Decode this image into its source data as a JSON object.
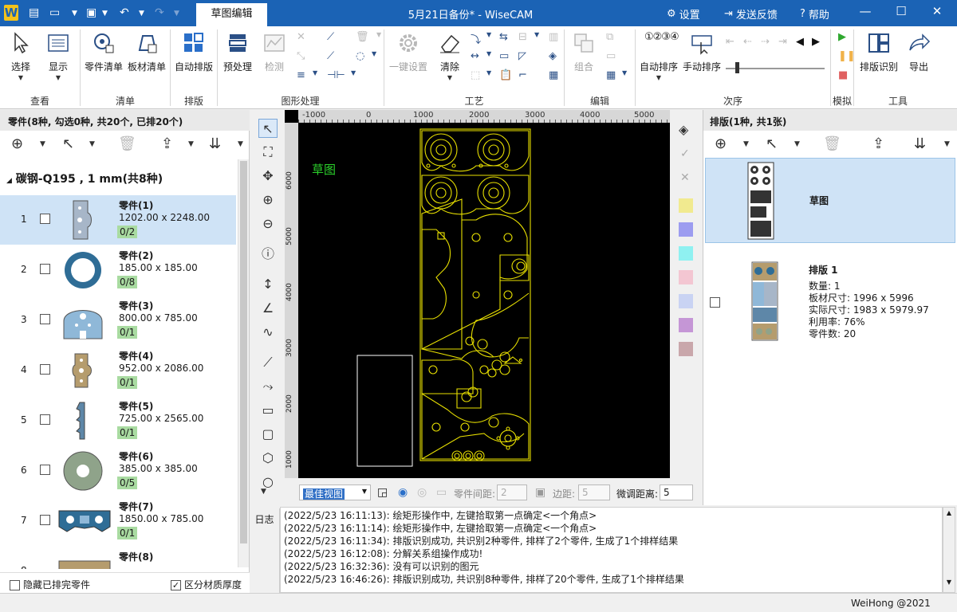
{
  "titlebar": {
    "logo": "W",
    "active_tab": "草图编辑",
    "title": "5月21日备份* - WiseCAM",
    "settings": "设置",
    "feedback": "发送反馈",
    "help": "帮助"
  },
  "ribbon": {
    "select": "选择",
    "display": "显示",
    "part_list": "零件清单",
    "sheet_list": "板材清单",
    "auto_nest": "自动排版",
    "preprocess": "预处理",
    "check": "检测",
    "one_click": "一键设置",
    "clear": "清除",
    "combine": "组合",
    "auto_sort": "自动排序",
    "manual_sort": "手动排序",
    "nest_recognize": "排版识别",
    "export": "导出",
    "order_icon_text": "①②③④",
    "groups": {
      "view": "查看",
      "list": "清单",
      "nest": "排版",
      "shape": "图形处理",
      "process": "工艺",
      "edit": "编辑",
      "order": "次序",
      "sim": "模拟",
      "tools": "工具"
    }
  },
  "left_panel": {
    "header": "零件(8种, 勾选0种, 共20个, 已排20个)",
    "group_title": "碳钢-Q195 , 1 mm(共8种)",
    "parts": [
      {
        "idx": "1",
        "name": "零件(1)",
        "dim": "1202.00 x 2248.00",
        "count": "0/2"
      },
      {
        "idx": "2",
        "name": "零件(2)",
        "dim": "185.00 x 185.00",
        "count": "0/8"
      },
      {
        "idx": "3",
        "name": "零件(3)",
        "dim": "800.00 x 785.00",
        "count": "0/1"
      },
      {
        "idx": "4",
        "name": "零件(4)",
        "dim": "952.00 x 2086.00",
        "count": "0/1"
      },
      {
        "idx": "5",
        "name": "零件(5)",
        "dim": "725.00 x 2565.00",
        "count": "0/1"
      },
      {
        "idx": "6",
        "name": "零件(6)",
        "dim": "385.00 x 385.00",
        "count": "0/5"
      },
      {
        "idx": "7",
        "name": "零件(7)",
        "dim": "1850.00 x 785.00",
        "count": "0/1"
      },
      {
        "idx": "8",
        "name": "零件(8)",
        "dim": "",
        "count": ""
      }
    ],
    "footer_hide": "隐藏已排完零件",
    "footer_split": "区分材质厚度",
    "footer_split_checked": "✓"
  },
  "canvas": {
    "label": "草图",
    "ruler_ticks": [
      "-1000",
      "0",
      "1000",
      "2000",
      "3000",
      "4000",
      "5000"
    ],
    "ruler_left_ticks": [
      "6000",
      "5000",
      "4000",
      "3000",
      "2000",
      "1000"
    ],
    "view_mode": "最佳视图",
    "part_gap_label": "零件间距:",
    "part_gap_value": "2",
    "margin_label": "边距:",
    "margin_value": "5",
    "fine_label": "微调距离:",
    "fine_value": "5"
  },
  "right_panel": {
    "header": "排版(1种, 共1张)",
    "draft_label": "草图",
    "sheet": {
      "title": "排版 1",
      "qty": "数量: 1",
      "sheet_size": "板材尺寸: 1996 x 5996",
      "actual_size": "实际尺寸: 1983 x 5979.97",
      "usage": "利用率: 76%",
      "parts": "零件数: 20"
    }
  },
  "log": {
    "label": "日志",
    "lines": [
      "(2022/5/23 16:11:13): 绘矩形操作中, 左键拾取第一点确定<一个角点>",
      "(2022/5/23 16:11:14): 绘矩形操作中, 左键拾取第一点确定<一个角点>",
      "(2022/5/23 16:11:34): 排版识别成功, 共识别2种零件, 排样了2个零件, 生成了1个排样结果",
      "(2022/5/23 16:12:08): 分解关系组操作成功!",
      "(2022/5/23 16:32:36): 没有可以识别的图元",
      "(2022/5/23 16:46:26): 排版识别成功, 共识别8种零件, 排样了20个零件, 生成了1个排样结果"
    ]
  },
  "status": {
    "copyright": "WeiHong @2021"
  },
  "colors": {
    "title_bar": "#1b63b5",
    "cad_line": "#e8e000",
    "cad_label": "#2bd12b",
    "part_fill": "#a7b6c8",
    "part_ring": "#2f6d96",
    "count_badge": "#a9dba1",
    "selection": "#cfe3f6",
    "swatches": [
      "#f1ea8f",
      "#9c9cf0",
      "#8ff1f1",
      "#f3c6d2",
      "#c9d3f3",
      "#c596d6",
      "#c9a7ab"
    ]
  }
}
